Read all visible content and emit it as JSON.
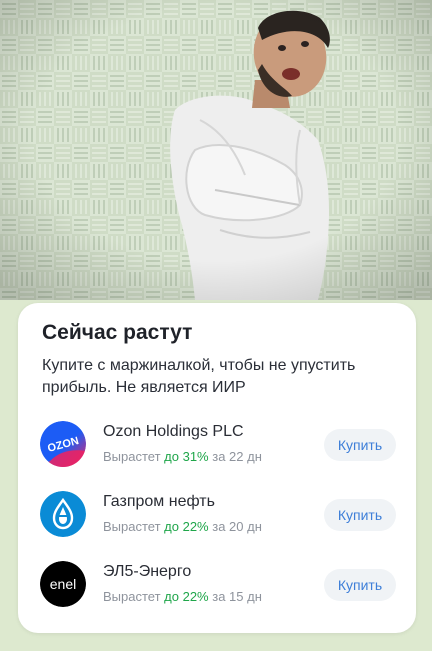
{
  "card": {
    "title": "Сейчас растут",
    "subtitle": "Купите с маржиналкой, чтобы не упустить прибыль. Не является ИИР"
  },
  "items": [
    {
      "name": "Ozon Holdings PLC",
      "growth_prefix": "Вырастет",
      "growth_value": "до 31%",
      "period": "за 22 дн",
      "button_label": "Купить",
      "logo_text": "OZON",
      "logo_colors": [
        "#1c5cf5",
        "#f0215f"
      ]
    },
    {
      "name": "Газпром нефть",
      "growth_prefix": "Вырастет",
      "growth_value": "до 22%",
      "period": "за 20 дн",
      "button_label": "Купить",
      "logo_colors": [
        "#0a8bd6"
      ]
    },
    {
      "name": "ЭЛ5-Энерго",
      "growth_prefix": "Вырастет",
      "growth_value": "до 22%",
      "period": "за 15 дн",
      "button_label": "Купить",
      "logo_text": "enel",
      "logo_colors": [
        "#000000"
      ]
    }
  ],
  "colors": {
    "accent": "#3d7ed8",
    "growth": "#1fa64a",
    "muted": "#8e939c"
  }
}
